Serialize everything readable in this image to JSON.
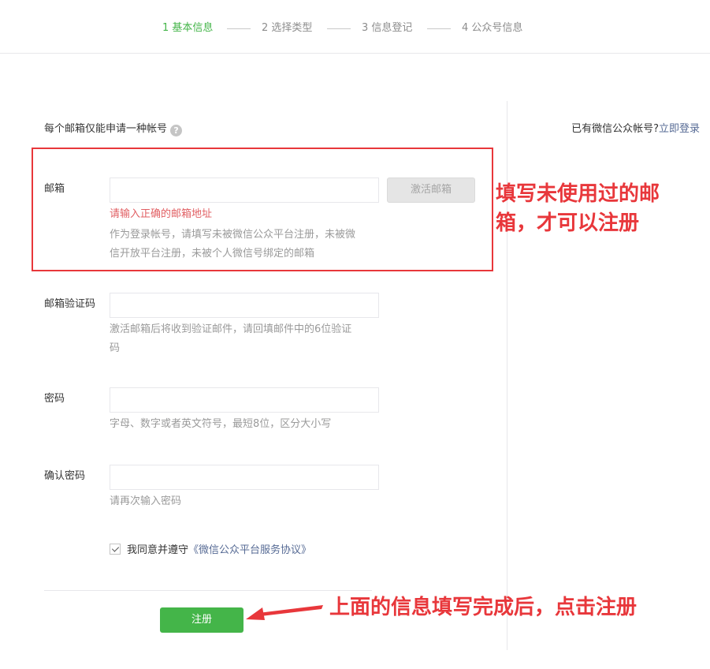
{
  "stepper": {
    "steps": [
      {
        "label": "1 基本信息",
        "active": true
      },
      {
        "label": "2 选择类型",
        "active": false
      },
      {
        "label": "3 信息登记",
        "active": false
      },
      {
        "label": "4 公众号信息",
        "active": false
      }
    ],
    "active_color": "#44b549",
    "inactive_color": "#8d8d8d"
  },
  "header_right": {
    "question": "已有微信公众帐号?",
    "login_link": "立即登录"
  },
  "form": {
    "tip": "每个邮箱仅能申请一种帐号",
    "help_icon": "question-circle-icon",
    "email": {
      "label": "邮箱",
      "value": "",
      "activate_button": "激活邮箱",
      "error": "请输入正确的邮箱地址",
      "description": "作为登录帐号，请填写未被微信公众平台注册，未被微信开放平台注册，未被个人微信号绑定的邮箱"
    },
    "verify_code": {
      "label": "邮箱验证码",
      "value": "",
      "description": "激活邮箱后将收到验证邮件，请回填邮件中的6位验证码"
    },
    "password": {
      "label": "密码",
      "value": "",
      "description": "字母、数字或者英文符号，最短8位，区分大小写"
    },
    "confirm_password": {
      "label": "确认密码",
      "value": "",
      "description": "请再次输入密码"
    },
    "agreement": {
      "checked": true,
      "text": "我同意并遵守",
      "link": "《微信公众平台服务协议》"
    },
    "register_button": "注册",
    "primary_color": "#44b549"
  },
  "annotations": {
    "email_note": "填写未使用过的邮箱，才可以注册",
    "register_note": "上面的信息填写完成后，点击注册",
    "color": "#e8373b"
  }
}
